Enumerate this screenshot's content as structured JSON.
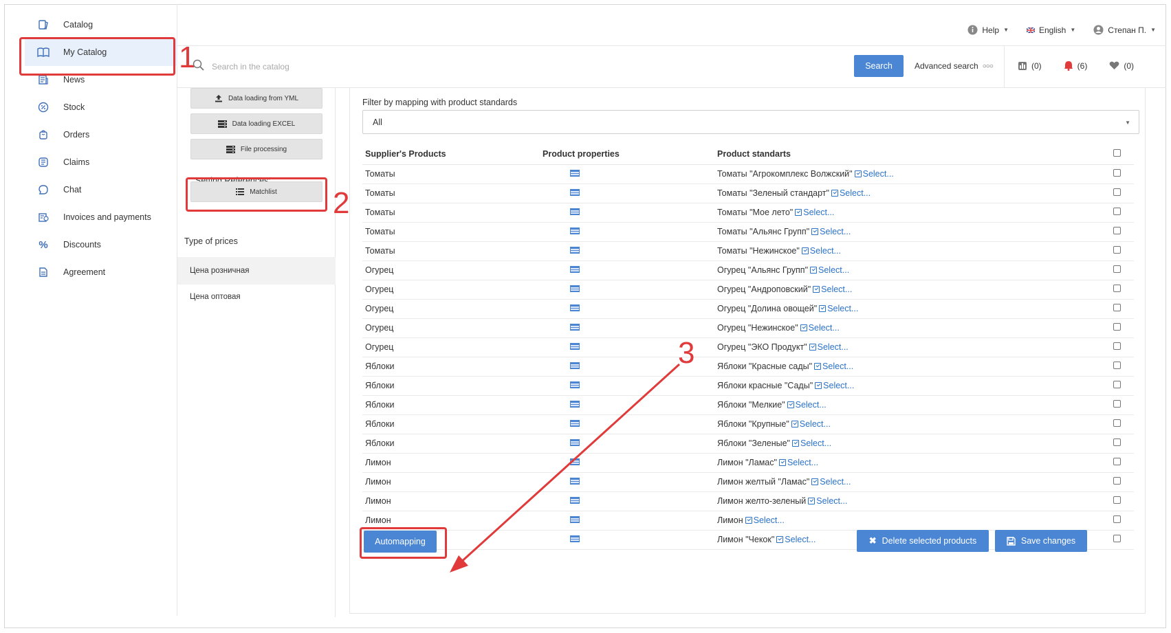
{
  "sidebar": {
    "items": [
      {
        "label": "Catalog",
        "icon": "catalog-icon"
      },
      {
        "label": "My Catalog",
        "icon": "book-icon"
      },
      {
        "label": "News",
        "icon": "news-icon"
      },
      {
        "label": "Stock",
        "icon": "percent-badge-icon"
      },
      {
        "label": "Orders",
        "icon": "bag-icon"
      },
      {
        "label": "Claims",
        "icon": "claims-icon"
      },
      {
        "label": "Chat",
        "icon": "chat-icon"
      },
      {
        "label": "Invoices and payments",
        "icon": "invoice-icon"
      },
      {
        "label": "Discounts",
        "icon": "percent-icon"
      },
      {
        "label": "Agreement",
        "icon": "document-icon"
      }
    ]
  },
  "topbar": {
    "help": "Help",
    "language": "English",
    "user": "Степан П."
  },
  "search": {
    "placeholder": "Search in the catalog",
    "button": "Search",
    "advanced": "Advanced search"
  },
  "counters": {
    "compare": "(0)",
    "notifications": "(6)",
    "favorites": "(0)"
  },
  "leftpanel": {
    "btn_yml": "Data loading from YML",
    "btn_excel": "Data loading EXCEL",
    "btn_file": "File processing",
    "setting_refs": "Setting References:",
    "btn_matchlist": "Matchlist",
    "type_prices": "Type of prices",
    "price_retail": "Цена розничная",
    "price_wholesale": "Цена оптовая"
  },
  "filter": {
    "label": "Filter by mapping with product standards",
    "value": "All"
  },
  "table": {
    "headers": [
      "Supplier's Products",
      "Product properties",
      "Product standarts"
    ],
    "select_link": "Select...",
    "rows": [
      {
        "product": "Томаты",
        "standard": "Томаты \"Агрокомплекс Волжский\""
      },
      {
        "product": "Томаты",
        "standard": "Томаты \"Зеленый стандарт\""
      },
      {
        "product": "Томаты",
        "standard": "Томаты \"Мое лето\""
      },
      {
        "product": "Томаты",
        "standard": "Томаты \"Альянс Групп\""
      },
      {
        "product": "Томаты",
        "standard": "Томаты \"Нежинское\""
      },
      {
        "product": "Огурец",
        "standard": "Огурец \"Альянс Групп\""
      },
      {
        "product": "Огурец",
        "standard": "Огурец \"Андроповский\""
      },
      {
        "product": "Огурец",
        "standard": "Огурец \"Долина овощей\""
      },
      {
        "product": "Огурец",
        "standard": "Огурец \"Нежинское\""
      },
      {
        "product": "Огурец",
        "standard": "Огурец \"ЭКО Продукт\""
      },
      {
        "product": "Яблоки",
        "standard": "Яблоки \"Красные сады\""
      },
      {
        "product": "Яблоки",
        "standard": "Яблоки красные \"Сады\""
      },
      {
        "product": "Яблоки",
        "standard": "Яблоки \"Мелкие\""
      },
      {
        "product": "Яблоки",
        "standard": "Яблоки \"Крупные\""
      },
      {
        "product": "Яблоки",
        "standard": "Яблоки \"Зеленые\""
      },
      {
        "product": "Лимон",
        "standard": "Лимон \"Ламас\""
      },
      {
        "product": "Лимон",
        "standard": "Лимон желтый \"Ламас\""
      },
      {
        "product": "Лимон",
        "standard": "Лимон желто-зеленый"
      },
      {
        "product": "Лимон",
        "standard": "Лимон"
      },
      {
        "product": "Лимон",
        "standard": "Лимон \"Чекок\""
      }
    ]
  },
  "actions": {
    "automapping": "Automapping",
    "delete": "Delete selected products",
    "save": "Save changes"
  },
  "annotations": {
    "n1": "1",
    "n2": "2",
    "n3": "3"
  },
  "colors": {
    "accent": "#4a86d4",
    "annotation": "#e03a3a",
    "link": "#2b72c9"
  }
}
